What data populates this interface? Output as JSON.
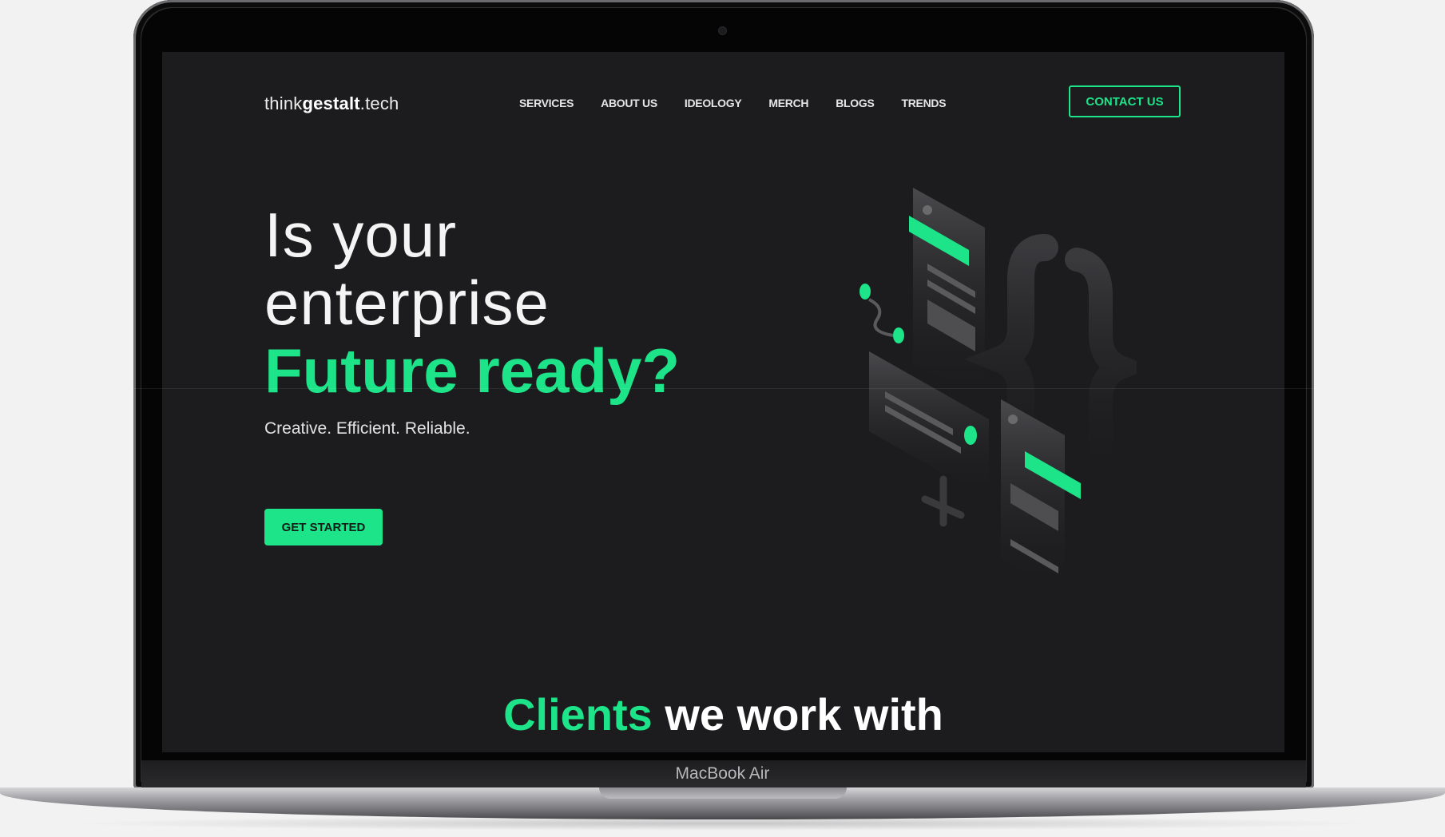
{
  "brand": {
    "prefix": "think",
    "bold": "gestalt",
    "suffix": ".tech"
  },
  "nav": {
    "items": [
      "SERVICES",
      "ABOUT US",
      "IDEOLOGY",
      "MERCH",
      "BLOGS",
      "TRENDS"
    ],
    "contact_label": "CONTACT US"
  },
  "hero": {
    "line1": "Is your",
    "line2": "enterprise",
    "accent": "Future ready?",
    "tagline": "Creative. Efficient. Reliable.",
    "cta_label": "GET STARTED"
  },
  "clients": {
    "accent": "Clients",
    "rest": " we work with"
  },
  "device": {
    "label": "MacBook Air"
  },
  "colors": {
    "accent": "#1de389",
    "background": "#1c1c1e"
  }
}
